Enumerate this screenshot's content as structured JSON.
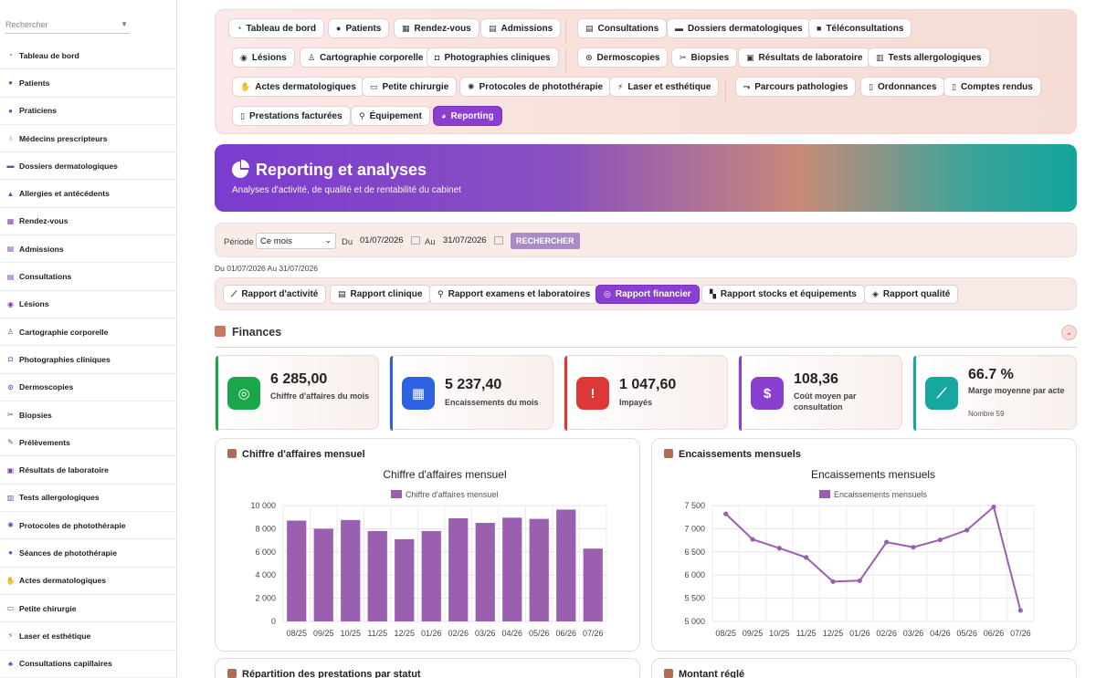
{
  "sidebar": {
    "search_placeholder": "Rechercher",
    "items": [
      {
        "label": "Tableau de bord",
        "icon": "dashboard-icon"
      },
      {
        "label": "Patients",
        "icon": "user-icon"
      },
      {
        "label": "Praticiens",
        "icon": "doctor-icon"
      },
      {
        "label": "Médecins prescripteurs",
        "icon": "stethoscope-icon"
      },
      {
        "label": "Dossiers dermatologiques",
        "icon": "folder-icon"
      },
      {
        "label": "Allergies et antécédents",
        "icon": "warning-icon"
      },
      {
        "label": "Rendez-vous",
        "icon": "calendar-icon"
      },
      {
        "label": "Admissions",
        "icon": "clipboard-icon"
      },
      {
        "label": "Consultations",
        "icon": "clipboard-check-icon"
      },
      {
        "label": "Lésions",
        "icon": "circle-dot-icon"
      },
      {
        "label": "Cartographie corporelle",
        "icon": "body-icon"
      },
      {
        "label": "Photographies cliniques",
        "icon": "camera-icon"
      },
      {
        "label": "Dermoscopies",
        "icon": "magnifier-icon"
      },
      {
        "label": "Biopsies",
        "icon": "scissors-icon"
      },
      {
        "label": "Prélèvements",
        "icon": "syringe-icon"
      },
      {
        "label": "Résultats de laboratoire",
        "icon": "lab-report-icon"
      },
      {
        "label": "Tests allergologiques",
        "icon": "test-grid-icon"
      },
      {
        "label": "Protocoles de photothérapie",
        "icon": "sun-icon"
      },
      {
        "label": "Séances de photothérapie",
        "icon": "bulb-icon"
      },
      {
        "label": "Actes dermatologiques",
        "icon": "hand-icon"
      },
      {
        "label": "Petite chirurgie",
        "icon": "bed-icon"
      },
      {
        "label": "Laser et esthétique",
        "icon": "bolt-icon"
      },
      {
        "label": "Consultations capillaires",
        "icon": "hair-icon"
      }
    ]
  },
  "nav": {
    "buttons": [
      {
        "label": "Tableau de bord",
        "icon": "dashboard-icon"
      },
      {
        "label": "Patients",
        "icon": "user-icon"
      },
      {
        "label": "Rendez-vous",
        "icon": "calendar-icon"
      },
      {
        "label": "Admissions",
        "icon": "clipboard-icon"
      },
      {
        "label": "Consultations",
        "icon": "clipboard-check-icon"
      },
      {
        "label": "Dossiers dermatologiques",
        "icon": "folder-icon"
      },
      {
        "label": "Téléconsultations",
        "icon": "video-icon"
      },
      {
        "label": "Lésions",
        "icon": "circle-dot-icon"
      },
      {
        "label": "Cartographie corporelle",
        "icon": "body-icon"
      },
      {
        "label": "Photographies cliniques",
        "icon": "camera-icon"
      },
      {
        "label": "Dermoscopies",
        "icon": "magnifier-icon"
      },
      {
        "label": "Biopsies",
        "icon": "scissors-icon"
      },
      {
        "label": "Résultats de laboratoire",
        "icon": "lab-report-icon"
      },
      {
        "label": "Tests allergologiques",
        "icon": "test-grid-icon"
      },
      {
        "label": "Actes dermatologiques",
        "icon": "hand-icon"
      },
      {
        "label": "Petite chirurgie",
        "icon": "bed-icon"
      },
      {
        "label": "Protocoles de photothérapie",
        "icon": "sun-icon"
      },
      {
        "label": "Laser et esthétique",
        "icon": "bolt-icon"
      },
      {
        "label": "Parcours pathologies",
        "icon": "route-icon"
      },
      {
        "label": "Ordonnances",
        "icon": "prescription-icon"
      },
      {
        "label": "Comptes rendus",
        "icon": "document-icon"
      },
      {
        "label": "Prestations facturées",
        "icon": "invoice-icon"
      },
      {
        "label": "Équipement",
        "icon": "microscope-icon"
      },
      {
        "label": "Reporting",
        "icon": "pie-chart-icon"
      }
    ],
    "active": "Reporting"
  },
  "hero": {
    "title": "Reporting et analyses",
    "subtitle": "Analyses d'activité, de qualité et de rentabilité du cabinet"
  },
  "filter": {
    "period_label": "Période",
    "period_value": "Ce mois",
    "from_label": "Du",
    "from_value": "01/07/2026",
    "to_label": "Au",
    "to_value": "31/07/2026",
    "search_button": "RECHERCHER"
  },
  "range_text": "Du 01/07/2026 Au 31/07/2026",
  "report_tabs": [
    {
      "label": "Rapport d'activité",
      "icon": "line-chart-icon"
    },
    {
      "label": "Rapport clinique",
      "icon": "clipboard-icon"
    },
    {
      "label": "Rapport examens et laboratoires",
      "icon": "microscope-icon"
    },
    {
      "label": "Rapport financier",
      "icon": "coins-icon"
    },
    {
      "label": "Rapport stocks et équipements",
      "icon": "boxes-icon"
    },
    {
      "label": "Rapport qualité",
      "icon": "shield-icon"
    }
  ],
  "active_report": "Rapport financier",
  "finances": {
    "title": "Finances",
    "kpis": [
      {
        "value": "6 285,00",
        "label": "Chiffre d'affaires du mois",
        "icon": "coins-icon",
        "color": "#1aa64a"
      },
      {
        "value": "5 237,40",
        "label": "Encaissements du mois",
        "icon": "cash-register-icon",
        "color": "#2d63e0"
      },
      {
        "value": "1 047,60",
        "label": "Impayés",
        "icon": "alert-triangle-icon",
        "color": "#dc3838"
      },
      {
        "value": "108,36",
        "label": "Coût moyen par consultation",
        "icon": "invoice-dollar-icon",
        "color": "#8a3fd1"
      },
      {
        "value": "66.7 %",
        "label": "Marge moyenne par acte",
        "sub": "Nombre 59",
        "icon": "trend-chart-icon",
        "color": "#16a7a0"
      }
    ]
  },
  "cards": {
    "revenue_title": "Chiffre d'affaires mensuel",
    "cash_title": "Encaissements mensuels",
    "status_title": "Répartition des prestations par statut",
    "paid_title": "Montant réglé"
  },
  "chart_data": [
    {
      "type": "bar",
      "title": "Chiffre d'affaires mensuel",
      "categories": [
        "08/25",
        "09/25",
        "10/25",
        "11/25",
        "12/25",
        "01/26",
        "02/26",
        "03/26",
        "04/26",
        "05/26",
        "06/26",
        "07/26"
      ],
      "series": [
        {
          "name": "Chiffre d'affaires mensuel",
          "values": [
            8700,
            8000,
            8750,
            7800,
            7100,
            7800,
            8900,
            8500,
            8950,
            8850,
            9650,
            6285
          ]
        }
      ],
      "ylim": [
        0,
        10000
      ],
      "yticks": [
        "10 000",
        "8 000",
        "6 000",
        "4 000",
        "2 000",
        "0"
      ],
      "color": "#9b5fb0",
      "grid": true,
      "legend": "top"
    },
    {
      "type": "line",
      "title": "Encaissements mensuels",
      "categories": [
        "08/25",
        "09/25",
        "10/25",
        "11/25",
        "12/25",
        "01/26",
        "02/26",
        "03/26",
        "04/26",
        "05/26",
        "06/26",
        "07/26"
      ],
      "series": [
        {
          "name": "Encaissements mensuels",
          "values": [
            7320,
            6770,
            6580,
            6380,
            5860,
            5880,
            6710,
            6600,
            6760,
            6970,
            7470,
            5237
          ]
        }
      ],
      "ylim": [
        5000,
        7500
      ],
      "yticks": [
        "7 500",
        "7 000",
        "6 500",
        "6 000",
        "5 500",
        "5 000"
      ],
      "color": "#9b5fb0",
      "grid": true,
      "legend": "top"
    }
  ]
}
